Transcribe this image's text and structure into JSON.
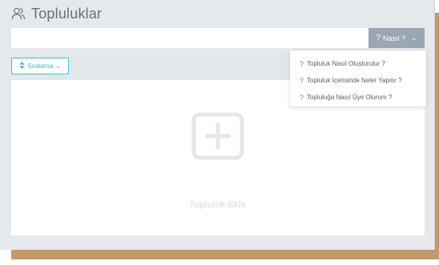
{
  "header": {
    "title": "Topluluklar",
    "icon": "users-icon"
  },
  "searchbar": {
    "value": ""
  },
  "nasil_button": {
    "label": "Nasıl ?",
    "icon": "question-circle-icon",
    "chevron": "⌄"
  },
  "sort_button": {
    "label": "Sıralama",
    "icon": "sort-icon",
    "chevron": "⌄"
  },
  "add_community": {
    "label": "Topluluk Ekle",
    "icon": "plus-square-icon"
  },
  "dropdown": {
    "items": [
      {
        "label": "Topluluk Nasıl Oluşturulur ?",
        "icon": "question-circle-icon"
      },
      {
        "label": "Topluluk İçerisinde Neler Yapılır ?",
        "icon": "question-circle-icon"
      },
      {
        "label": "Topluluğa Nasıl Üye Olurum ?",
        "icon": "question-circle-icon"
      }
    ]
  },
  "colors": {
    "panel_bg": "#e6e9ec",
    "accent": "#3fc0d5",
    "button_gray": "#9aa7b3",
    "frame_brown": "#c19a6b"
  }
}
